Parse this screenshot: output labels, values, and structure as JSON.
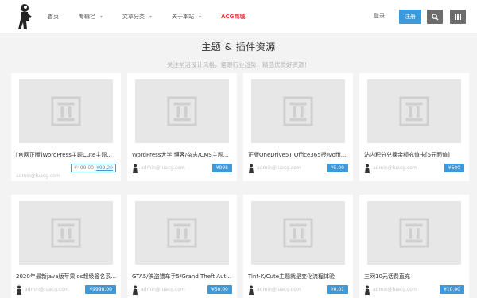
{
  "header": {
    "nav": [
      {
        "label": "首页",
        "caret": false
      },
      {
        "label": "专辑栏",
        "caret": true
      },
      {
        "label": "文章分类",
        "caret": true
      },
      {
        "label": "关于本站",
        "caret": true
      },
      {
        "label": "ACG商城",
        "caret": false
      }
    ],
    "login_label": "登录",
    "register_label": "注册"
  },
  "page": {
    "title": "主题 & 插件资源",
    "subtitle": "关注前沿设计风格，紧跟行业趋势，精选优质好资源！"
  },
  "cards": [
    {
      "title": "[官网正版]WordPress主题Cute主题...",
      "author": "admin@luacg.com",
      "price_old": "¥499.00",
      "price_new": "¥99.20",
      "price": ""
    },
    {
      "title": "WordPress大学 博客/杂志/CMS主题...",
      "author": "admin@luacg.com",
      "price": "¥998"
    },
    {
      "title": "正版OneDrive5T Office365授权offi...",
      "author": "admin@luacg.com",
      "price": "¥5.00"
    },
    {
      "title": "站内积分兑换余额充值卡[5元面值]",
      "author": "admin@luacg.com",
      "price": "¥600"
    },
    {
      "title": "2020年最新java版苹果ios超级签名系...",
      "author": "admin@luacg.com",
      "price": "¥9998.00"
    },
    {
      "title": "GTA5/侠盗猎车手5/Grand Theft Aut...",
      "author": "admin@luacg.com",
      "price": "¥50.00"
    },
    {
      "title": "Tint-K/Cute主题就是变化流程体验",
      "author": "admin@luacg.com",
      "price": "¥0.01"
    },
    {
      "title": "三网10元话费直充",
      "author": "admin@luacg.com",
      "price": "¥10.00"
    }
  ],
  "colors": {
    "accent": "#3b99dc",
    "acg": "#e23a3a",
    "dark_btn": "#6c6c6c"
  }
}
